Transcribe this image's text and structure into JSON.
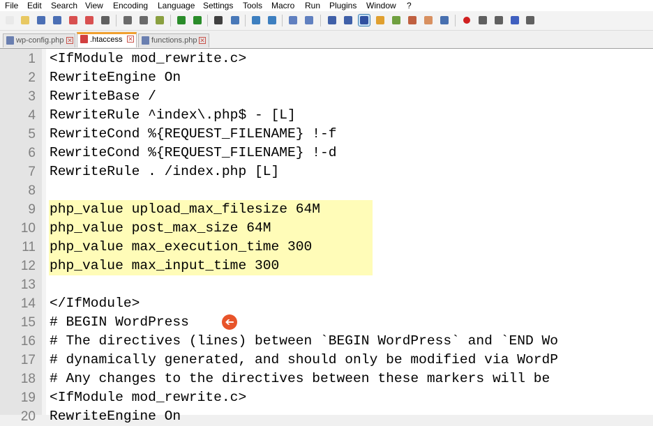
{
  "menu": [
    "File",
    "Edit",
    "Search",
    "View",
    "Encoding",
    "Language",
    "Settings",
    "Tools",
    "Macro",
    "Run",
    "Plugins",
    "Window",
    "?"
  ],
  "toolbar_icons": [
    "new-file-icon",
    "open-file-icon",
    "save-icon",
    "save-all-icon",
    "close-icon",
    "close-all-icon",
    "print-icon",
    "cut-icon",
    "copy-icon",
    "paste-icon",
    "undo-icon",
    "redo-icon",
    "find-icon",
    "replace-icon",
    "zoom-in-icon",
    "zoom-out-icon",
    "sync-vertical-icon",
    "sync-horizontal-icon",
    "word-wrap-icon",
    "show-all-chars-icon",
    "indent-guide-icon",
    "language-define-icon",
    "doc-map-icon",
    "function-list-icon",
    "folder-workspace-icon",
    "monitoring-icon",
    "record-macro-icon",
    "stop-record-icon",
    "play-macro-icon",
    "run-macro-multiple-icon",
    "save-macro-icon"
  ],
  "tabs": [
    {
      "label": "wp-config.php"
    },
    {
      "label": ".htaccess"
    },
    {
      "label": "functions.php"
    }
  ],
  "tab_close_glyph": "✕",
  "lines": [
    {
      "num": "1",
      "text": "<IfModule mod_rewrite.c>"
    },
    {
      "num": "2",
      "text": "RewriteEngine On"
    },
    {
      "num": "3",
      "text": "RewriteBase /"
    },
    {
      "num": "4",
      "text": "RewriteRule ^index\\.php$ - [L]"
    },
    {
      "num": "5",
      "text": "RewriteCond %{REQUEST_FILENAME} !-f"
    },
    {
      "num": "6",
      "text": "RewriteCond %{REQUEST_FILENAME} !-d"
    },
    {
      "num": "7",
      "text": "RewriteRule . /index.php [L]"
    },
    {
      "num": "8",
      "text": ""
    },
    {
      "num": "9",
      "text": "php_value upload_max_filesize 64M"
    },
    {
      "num": "10",
      "text": "php_value post_max_size 64M"
    },
    {
      "num": "11",
      "text": "php_value max_execution_time 300"
    },
    {
      "num": "12",
      "text": "php_value max_input_time 300"
    },
    {
      "num": "13",
      "text": ""
    },
    {
      "num": "14",
      "text": "</IfModule>"
    },
    {
      "num": "15",
      "text": "# BEGIN WordPress"
    },
    {
      "num": "16",
      "text": "# The directives (lines) between `BEGIN WordPress` and `END Wo"
    },
    {
      "num": "17",
      "text": "# dynamically generated, and should only be modified via WordP"
    },
    {
      "num": "18",
      "text": "# Any changes to the directives between these markers will be"
    },
    {
      "num": "19",
      "text": "<IfModule mod_rewrite.c>"
    },
    {
      "num": "20",
      "text": "RewriteEngine On"
    }
  ],
  "highlighted_lines": [
    "9",
    "10",
    "11",
    "12"
  ],
  "arrow_glyph": "➔",
  "colors": {
    "highlight": "#fffcb8",
    "active_tab_accent": "#f0a030",
    "arrow": "#e8542a"
  }
}
